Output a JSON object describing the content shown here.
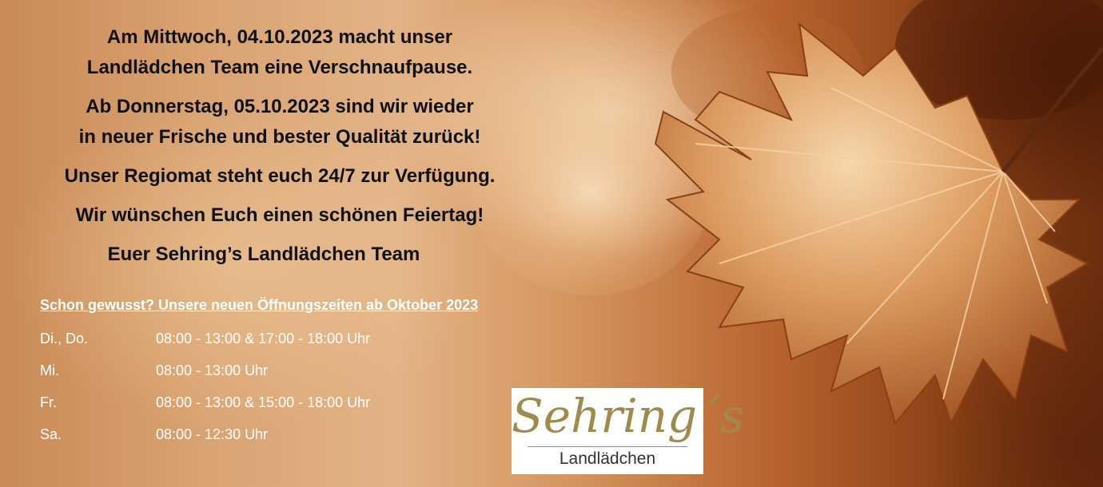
{
  "announcement": {
    "lines": [
      "Am Mittwoch, 04.10.2023 macht unser",
      "Landlädchen Team eine Verschnaufpause.",
      "Ab Donnerstag, 05.10.2023 sind wir wieder",
      "in neuer Frische und bester Qualität zurück!",
      "Unser Regiomat steht euch 24/7 zur Verfügung.",
      "Wir wünschen Euch einen schönen Feiertag!",
      "Euer Sehring’s Landlädchen Team"
    ]
  },
  "opening_hours": {
    "heading": "Schon gewusst? Unsere neuen Öffnungszeiten ab Oktober 2023",
    "rows": [
      {
        "day": "Di., Do.",
        "time": "08:00 - 13:00 & 17:00 - 18:00 Uhr"
      },
      {
        "day": "Mi.",
        "time": "08:00 - 13:00 Uhr"
      },
      {
        "day": "Fr.",
        "time": "08:00 - 13:00 & 15:00 - 18:00 Uhr"
      },
      {
        "day": "Sa.",
        "time": "08:00 - 12:30 Uhr"
      }
    ]
  },
  "logo": {
    "name": "Sehring´s",
    "subtitle": "Landlädchen"
  },
  "colors": {
    "logo_gold": "#a08a4a",
    "leaf_light": "#f0c89a",
    "leaf_mid": "#c9743a",
    "leaf_dark": "#7a3410"
  },
  "background_image": "autumn-maple-leaf"
}
